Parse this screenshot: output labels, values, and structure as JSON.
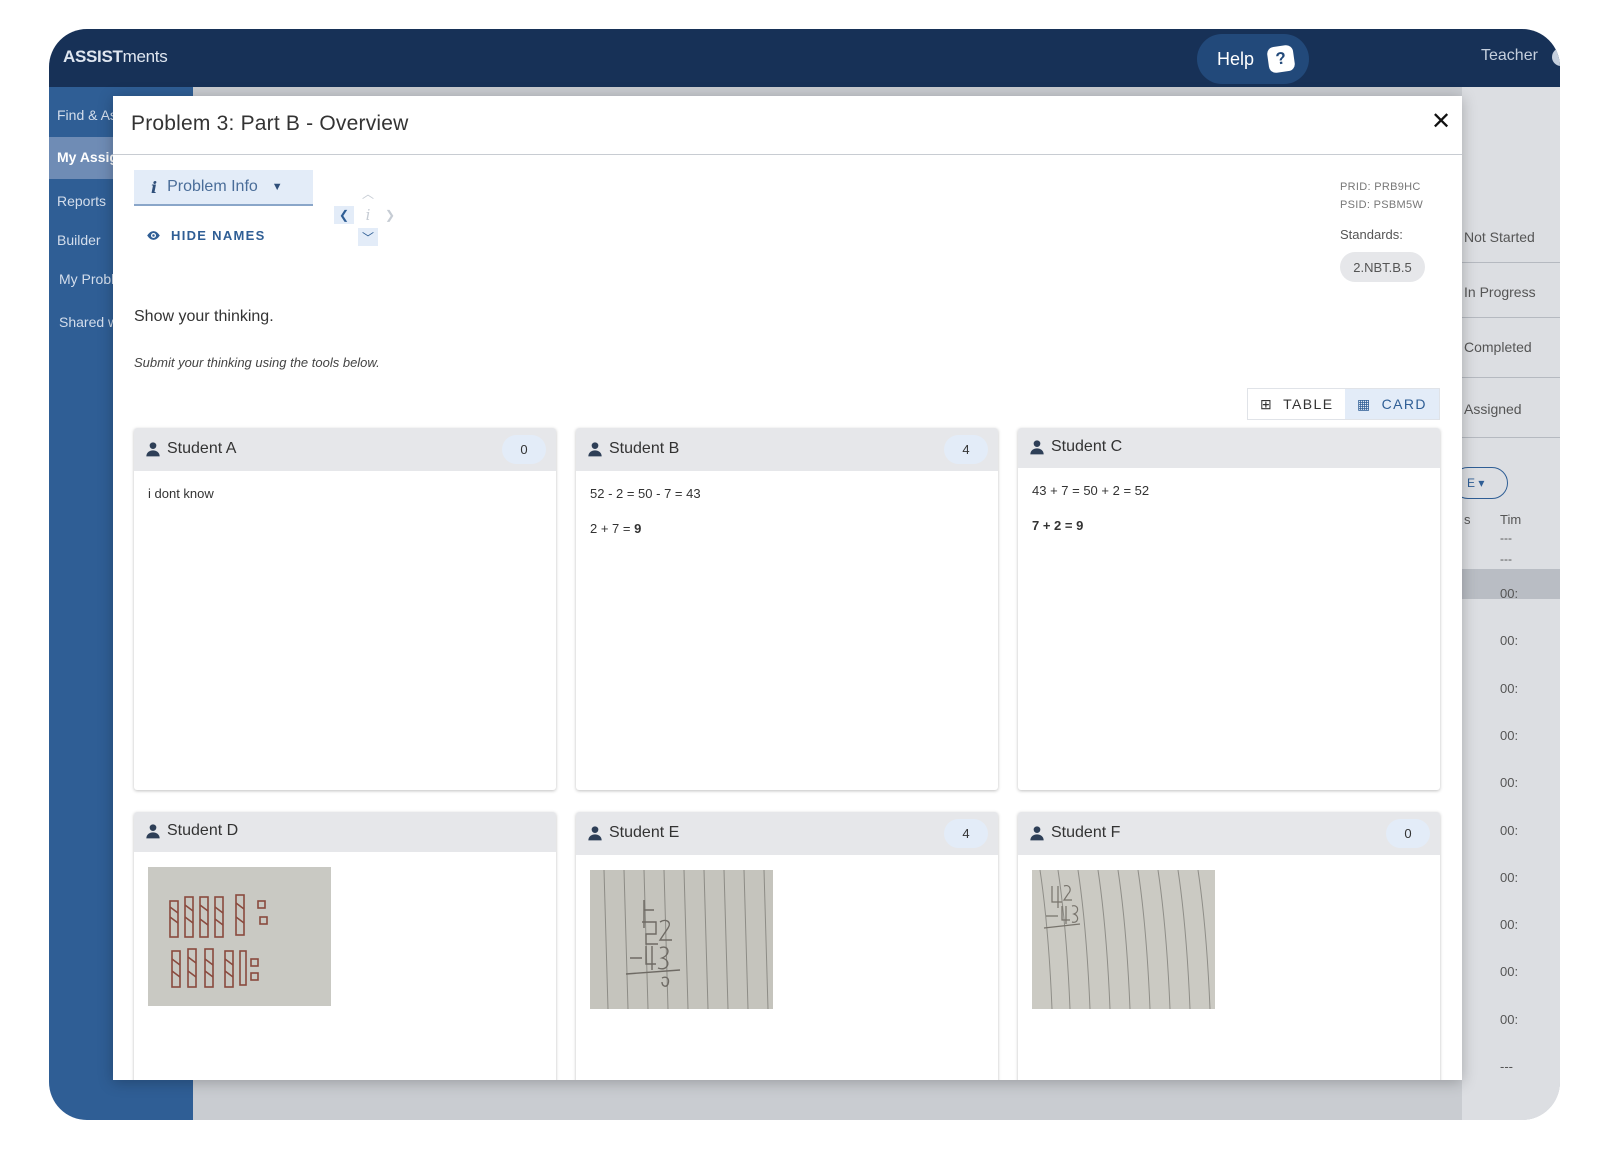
{
  "app": {
    "logo_bold": "ASSIST",
    "logo_light": "ments",
    "help_label": "Help",
    "help_icon": "question-bubble-icon",
    "user_label": "Teacher"
  },
  "sidebar": {
    "items": [
      {
        "label": "Find & Assign"
      },
      {
        "label": "My Assignments",
        "active": true
      },
      {
        "label": "Reports"
      },
      {
        "label": "Builder"
      },
      {
        "label": "My Problems"
      },
      {
        "label": "Shared with me"
      }
    ]
  },
  "background_table": {
    "statuses": [
      "Not Started",
      "In Progress",
      "Completed",
      "Assigned"
    ],
    "filter_label": "E",
    "columns": [
      "s",
      "Tim"
    ],
    "header_values": [
      "---",
      "---"
    ],
    "row_values": [
      "00:",
      "00:",
      "00:",
      "00:",
      "00:",
      "00:",
      "00:",
      "00:",
      "00:",
      "00:",
      "---"
    ]
  },
  "modal": {
    "title": "Problem 3: Part B - Overview",
    "problem_info_label": "Problem Info",
    "hide_names_label": "HIDE NAMES",
    "prid": "PRID: PRB9HC",
    "psid": "PSID: PSBM5W",
    "standards_label": "Standards:",
    "standard": "2.NBT.B.5",
    "prompt": "Show your thinking.",
    "instructions": "Submit your thinking using the tools below.",
    "view_table_label": "TABLE",
    "view_card_label": "CARD",
    "selected_view": "CARD"
  },
  "students": [
    {
      "name": "Student A",
      "count": "0",
      "line1": "i dont know",
      "line2_prefix": "",
      "line2_bold": ""
    },
    {
      "name": "Student B",
      "count": "4",
      "line1": "52 - 2 = 50 - 7 = 43",
      "line2_prefix": "2 + 7 = ",
      "line2_bold": "9"
    },
    {
      "name": "Student C",
      "count": "",
      "line1": "43 + 7 = 50 + 2 = 52",
      "line2_prefix": "",
      "line2_bold": "7 + 2 = 9"
    },
    {
      "name": "Student D",
      "count": "",
      "image": "photo of tally marks drawing"
    },
    {
      "name": "Student E",
      "count": "4",
      "image": "photo of handwritten subtraction on lined paper"
    },
    {
      "name": "Student F",
      "count": "0",
      "image": "photo of handwritten work on lined paper"
    }
  ],
  "colors": {
    "navy": "#173157",
    "sidebar": "#2f5e95",
    "accent": "#2f5e95",
    "chip_bg": "#e3ecf8",
    "card_header": "#e6e7ea"
  }
}
